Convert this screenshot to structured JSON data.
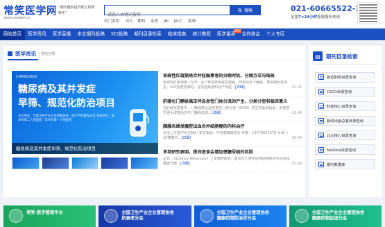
{
  "header": {
    "logo": "常笑医学网",
    "logo_url": "www.cxwebi.cn",
    "slogan": "“期刊服务提升助力科研转化”",
    "search_placeholder": "请输入关键词搜索",
    "search_button": "搜索",
    "hot_label": "热门搜索:",
    "hot_keywords": [
      "SCI",
      "期刊",
      "杂志",
      "JBI",
      "JACC",
      "影响"
    ],
    "phone": "021-60665522-3",
    "phone_sub_prefix": "全国",
    "phone_sub_bold": "7×24小时",
    "phone_sub_suffix": "客服服务热线"
  },
  "nav": {
    "items": [
      {
        "label": "网站首页",
        "active": true
      },
      {
        "label": "医学资讯"
      },
      {
        "label": "医学直播"
      },
      {
        "label": "中文期刊投稿"
      },
      {
        "label": "SCI投稿"
      },
      {
        "label": "期刊目录检索"
      },
      {
        "label": "临床指南"
      },
      {
        "label": "统计教程"
      },
      {
        "label": "医学量表",
        "tag": "NEW"
      },
      {
        "label": "合作协会"
      },
      {
        "label": "个人专区"
      }
    ]
  },
  "news_section": {
    "title": "医学资讯",
    "more": "| 查看全部",
    "banner": {
      "logo": "CHANGXIAO",
      "headline1": "糖尿病及其并发症",
      "headline2": "早筛、规范化防治项目",
      "meta": "主办单位：全国卫生产业企业管理协会 · 医疗学科建设分会  承办单位：常州市第二人民医院 · 常州市第一人民医院",
      "caption": "糖尿病及其并发症早筛、规范化防治项目"
    },
    "news": [
      {
        "title": "系统性红斑狼疮合并妊娠患者的分娩时机、分娩方式与结局",
        "summary": "系统性红斑狼疮（SLE）是一种自身免疫性疾病，可累及多个器官，育龄期女性多见。SLE患者妊娠时，在风湿免疫科及产科医...",
        "more": "[详细]",
        "date": "03-06"
      },
      {
        "title": "肝硬化门静脉高压伴自发性门体分流的产生、分类分型和临床意义",
        "summary": "在肝硬化患者中，门静脉高压是自发性门体分流（SPSS）发生的驱动因素。肝脏发生硬化改变后均可门静脉血流...",
        "more": "[详细]",
        "date": "03-06"
      },
      {
        "title": "胰腺炎继发腹腔出血合并结肠瘘的内科治疗",
        "summary": "点击上方蓝字关注我们 本文来源：中华胰腺病杂志 作者：19778655678 手术门诊/胰腺炎...",
        "more": "[详细]",
        "date": "03-06"
      },
      {
        "title": "多项研究表明，夜间进食会增加患糖尿病的风险",
        "summary": "近日，《Science Advances》上发表的研究，首次在人类中证明进食时间与对机体昼夜节律...",
        "more": "[详细]",
        "date": "03-06"
      }
    ]
  },
  "journal_section": {
    "title": "期刊目录检索",
    "items": [
      "各省职称目录查询",
      "CSCD目录查询",
      "科技核心目录查询",
      "新闻出版总署目录查询",
      "北大核心目录查询",
      "Medline目录查询",
      "期刊数据库"
    ]
  },
  "ads": [
    "常笑·医学管理平台",
    "全国卫生产业企业管理协会\n抗衰老分会",
    "全国卫生产业企业管理协会\n健康药物防治学分会",
    "全国卫生产业企业管理协会\n健康药物促进分会"
  ],
  "colors": {
    "brand": "#1c4fc0",
    "nav_bg": "#1c4fc0",
    "tag_new": "#f0552b"
  }
}
